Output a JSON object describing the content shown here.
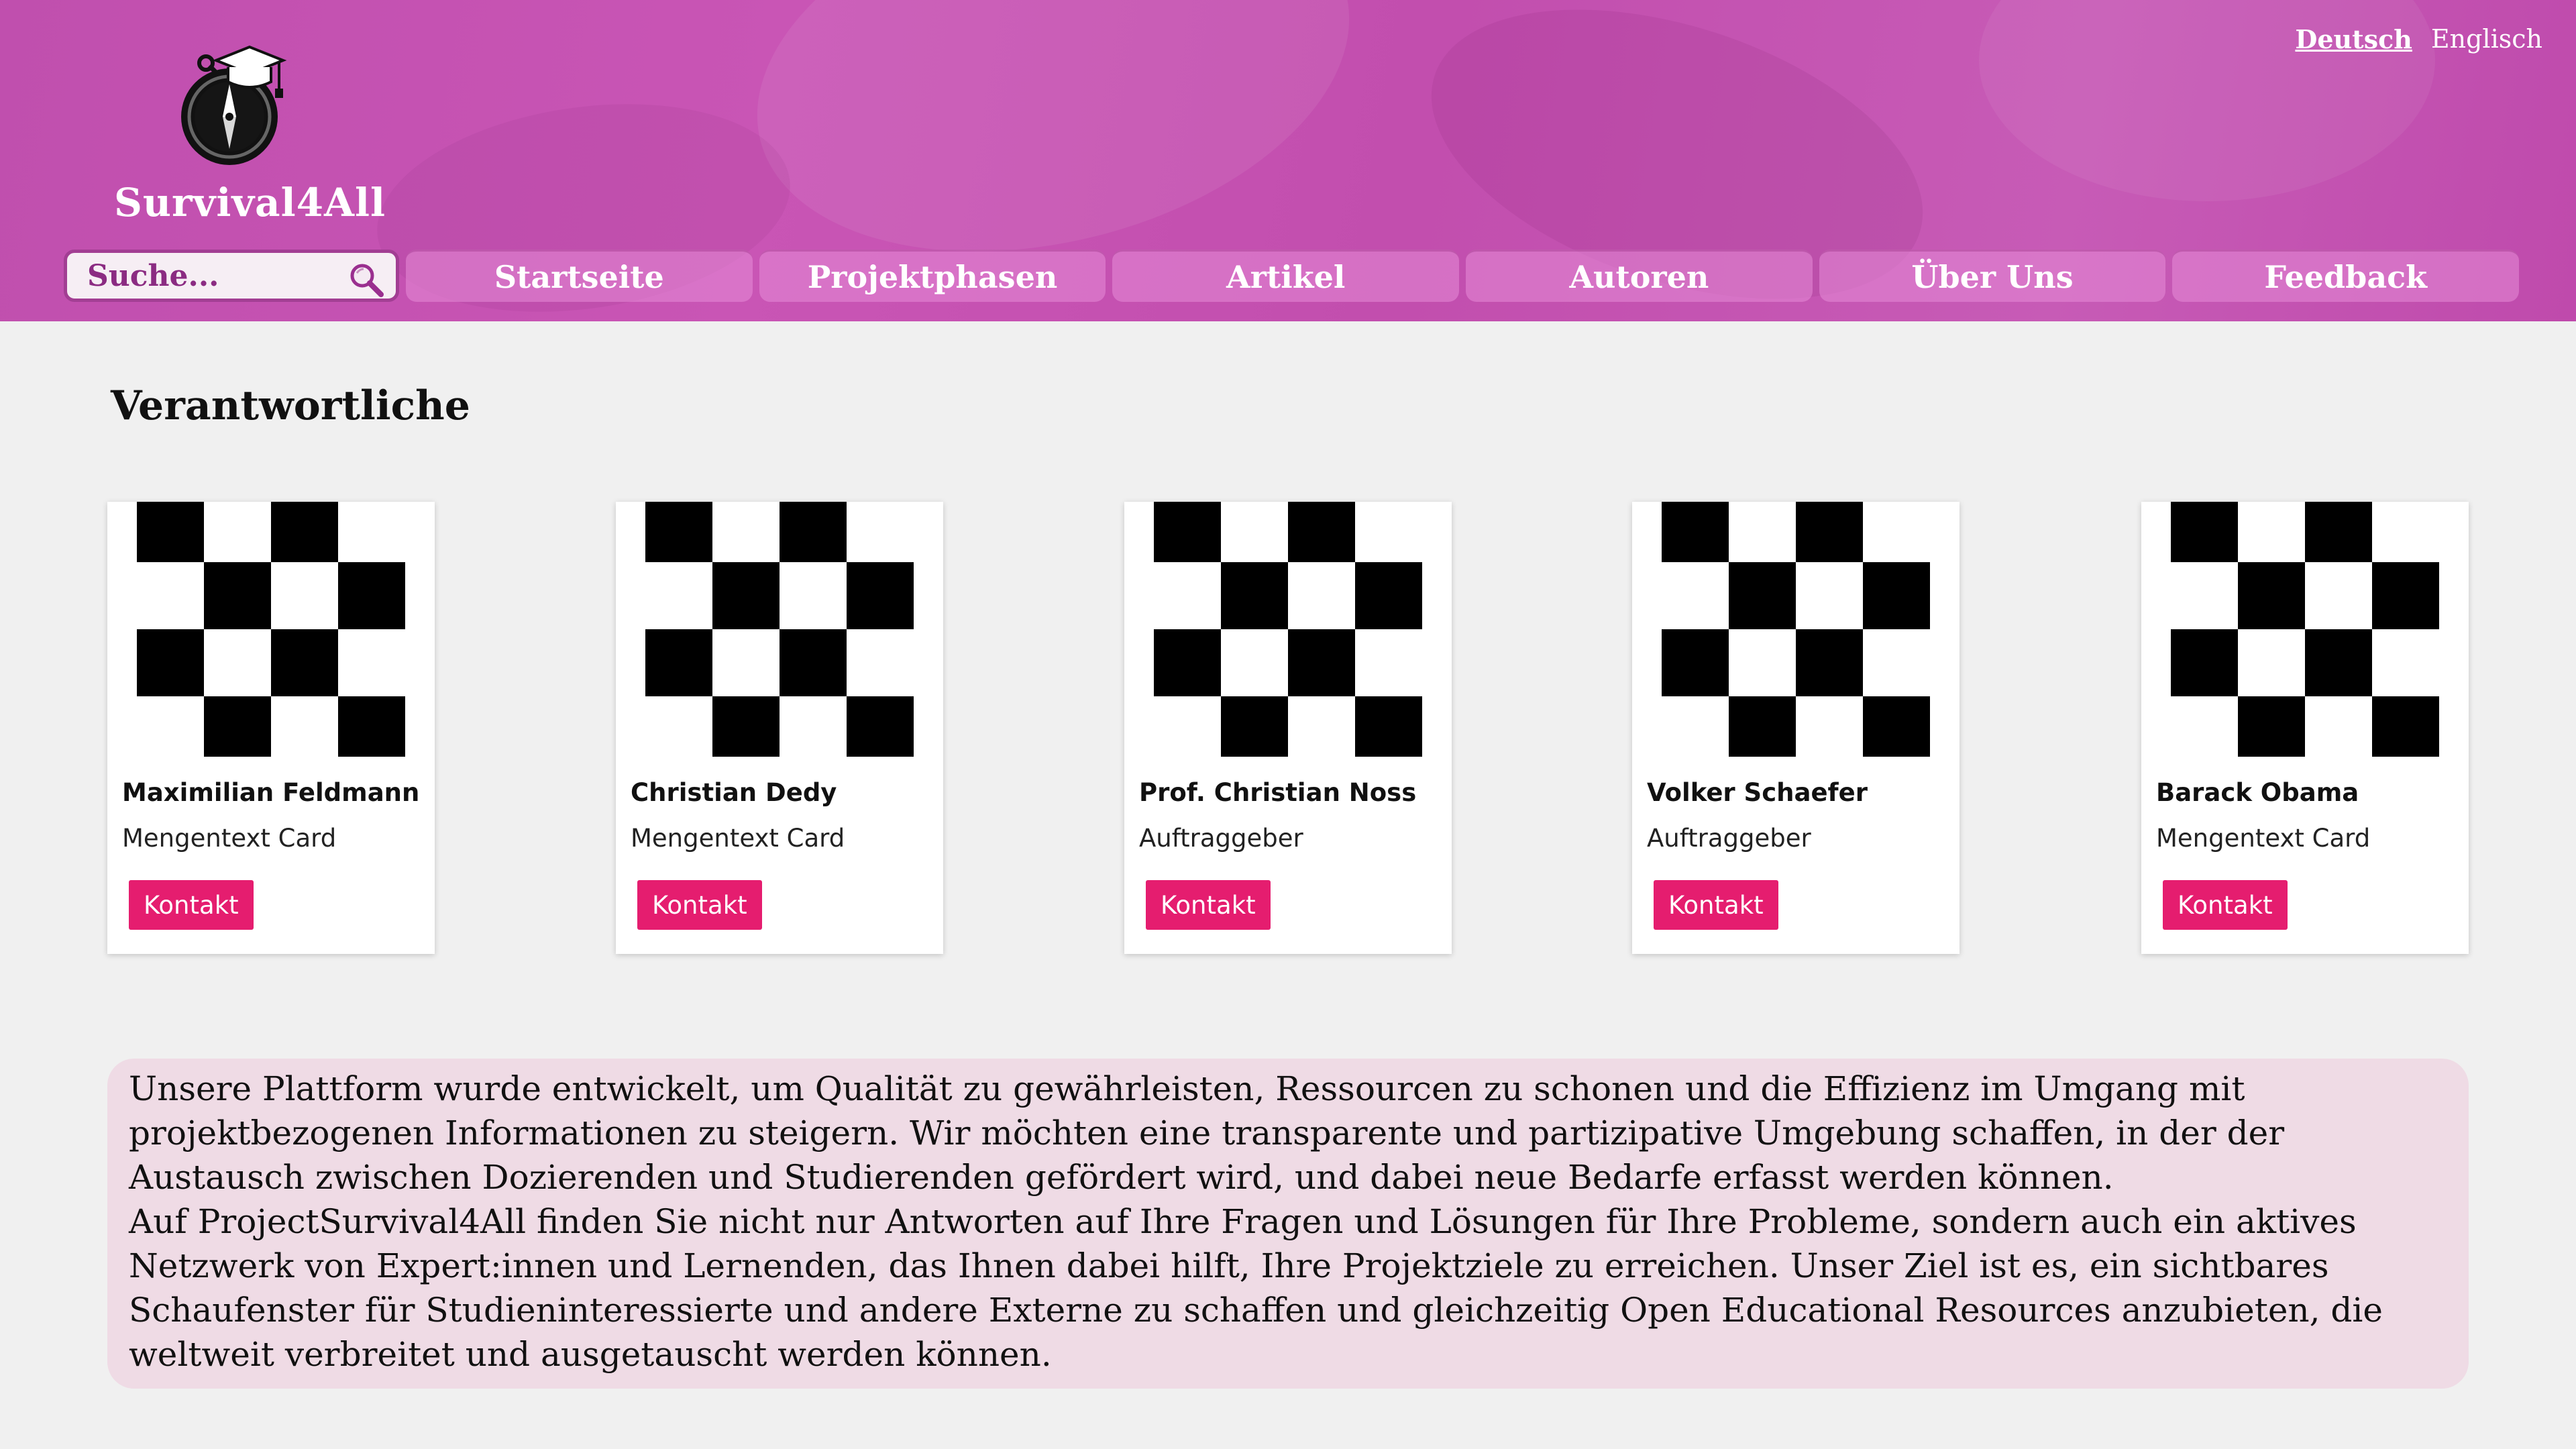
{
  "colors": {
    "header": "#c24eae",
    "accent_button": "#e51d6f",
    "about_background": "#efdbe5",
    "page_background": "#f0f0f0"
  },
  "header": {
    "brand": "Survival4All",
    "logo_icon": "compass-graduation-cap-icon",
    "languages": [
      {
        "label": "Deutsch",
        "active": true
      },
      {
        "label": "Englisch",
        "active": false
      }
    ]
  },
  "search": {
    "placeholder": "Suche...",
    "icon": "magnifier-icon"
  },
  "nav": {
    "items": [
      "Startseite",
      "Projektphasen",
      "Artikel",
      "Autoren",
      "Über Uns",
      "Feedback"
    ]
  },
  "main": {
    "section_title": "Verantwortliche",
    "cards": [
      {
        "name": "Maximilian Feldmann",
        "role": "Mengentext Card",
        "button": "Kontakt"
      },
      {
        "name": "Christian Dedy",
        "role": "Mengentext Card",
        "button": "Kontakt"
      },
      {
        "name": "Prof. Christian Noss",
        "role": "Auftraggeber",
        "button": "Kontakt"
      },
      {
        "name": "Volker Schaefer",
        "role": "Auftraggeber",
        "button": "Kontakt"
      },
      {
        "name": "Barack Obama",
        "role": "Mengentext Card",
        "button": "Kontakt"
      }
    ],
    "about": {
      "paragraph1": "Unsere Plattform wurde entwickelt, um Qualität zu gewährleisten, Ressourcen zu schonen und die Effizienz im Umgang mit projektbezogenen Informationen zu steigern. Wir möchten eine transparente und partizipative Umgebung schaffen, in der der Austausch zwischen Dozierenden und Studierenden gefördert wird, und dabei neue Bedarfe erfasst werden können.",
      "paragraph2": "Auf ProjectSurvival4All finden Sie nicht nur Antworten auf Ihre Fragen und Lösungen für Ihre Probleme, sondern auch ein aktives Netzwerk von Expert:innen und Lernenden, das Ihnen dabei hilft, Ihre Projektziele zu erreichen. Unser Ziel ist es, ein sichtbares Schaufenster für Studieninteressierte und andere Externe zu schaffen und gleichzeitig Open Educational Resources anzubieten, die weltweit verbreitet und ausgetauscht werden können."
    }
  }
}
